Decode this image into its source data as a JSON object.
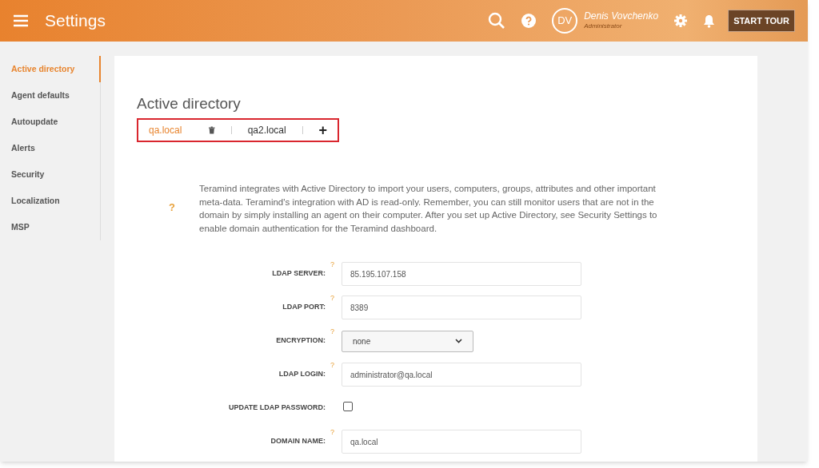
{
  "header": {
    "title": "Settings",
    "user": {
      "initials": "DV",
      "name": "Denis Vovchenko",
      "role": "Administrator"
    },
    "tour_button": "START TOUR"
  },
  "sidebar": {
    "items": [
      {
        "label": "Active directory",
        "selected": true
      },
      {
        "label": "Agent defaults",
        "selected": false
      },
      {
        "label": "Autoupdate",
        "selected": false
      },
      {
        "label": "Alerts",
        "selected": false
      },
      {
        "label": "Security",
        "selected": false
      },
      {
        "label": "Localization",
        "selected": false
      },
      {
        "label": "MSP",
        "selected": false
      }
    ]
  },
  "page_title": "Active directory",
  "domain_tabs": [
    {
      "label": "qa.local",
      "selected": true,
      "deletable": true
    },
    {
      "label": "qa2.local",
      "selected": false,
      "deletable": false
    }
  ],
  "add_tab": "+",
  "info": {
    "help": "?",
    "text": "Teramind integrates with Active Directory to import your users, computers, groups, attributes and other important meta-data. Teramind's integration with AD is read-only. Remember, you can still monitor users that are not in the domain by simply installing an agent on their computer. After you set up Active Directory, see Security Settings to enable domain authentication for the Teramind dashboard."
  },
  "fields": [
    {
      "kind": "text",
      "label": "LDAP SERVER:",
      "help": "?",
      "value": "85.195.107.158"
    },
    {
      "kind": "text",
      "label": "LDAP PORT:",
      "help": "?",
      "value": "8389"
    },
    {
      "kind": "select",
      "label": "ENCRYPTION:",
      "help": "?",
      "value": "none"
    },
    {
      "kind": "text",
      "label": "LDAP LOGIN:",
      "help": "?",
      "value": "administrator@qa.local"
    },
    {
      "kind": "checkbox",
      "label": "UPDATE LDAP PASSWORD:",
      "checked": false
    },
    {
      "kind": "text",
      "label": "DOMAIN NAME:",
      "help": "?",
      "value": "qa.local"
    }
  ]
}
